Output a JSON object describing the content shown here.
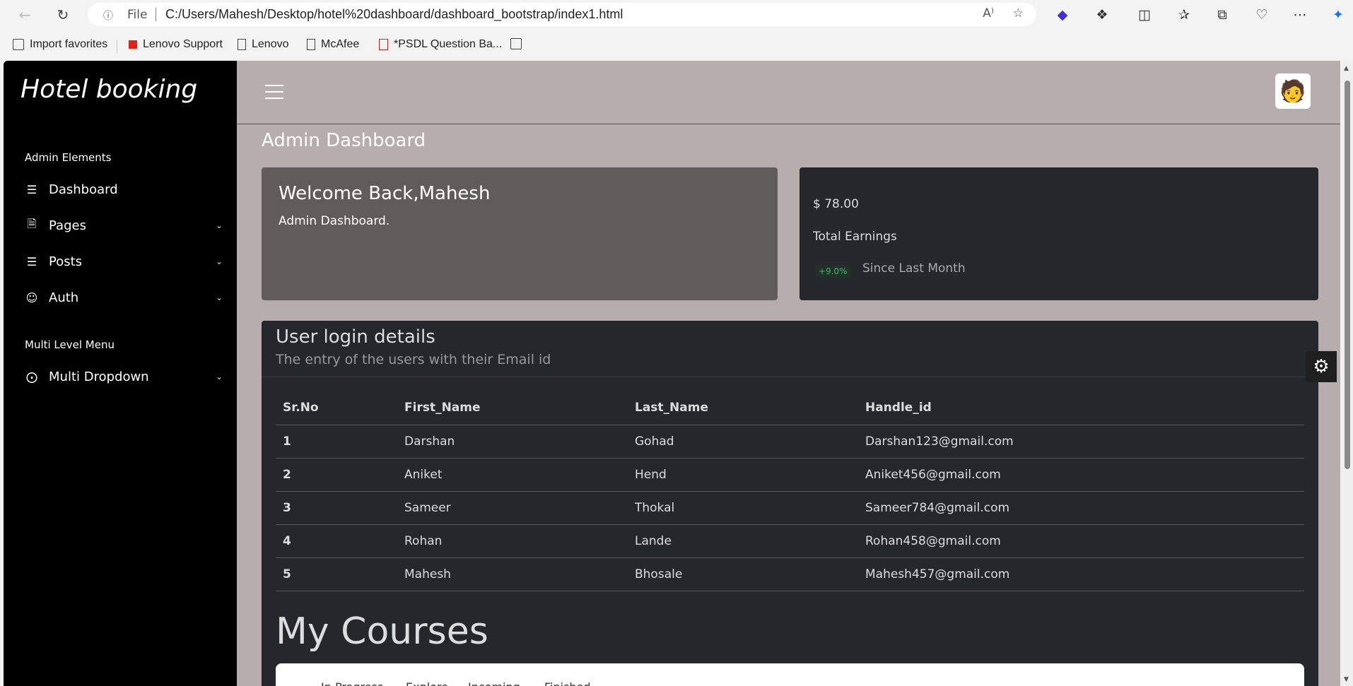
{
  "browser": {
    "file_label": "File",
    "url": "C:/Users/Mahesh/Desktop/hotel%20dashboard/dashboard_bootstrap/index1.html",
    "bookmarks": [
      {
        "label": "Import favorites",
        "icon": "import-icon"
      },
      {
        "label": "Lenovo Support",
        "icon": "lenovo-icon"
      },
      {
        "label": "Lenovo",
        "icon": "page-icon"
      },
      {
        "label": "McAfee",
        "icon": "page-icon"
      },
      {
        "label": "*PSDL Question Ba...",
        "icon": "pdf-icon"
      }
    ]
  },
  "sidebar": {
    "brand": "Hotel booking",
    "heading_admin": "Admin Elements",
    "items": [
      {
        "label": "Dashboard",
        "icon": "list-icon",
        "has_dropdown": false
      },
      {
        "label": "Pages",
        "icon": "file-icon",
        "has_dropdown": true
      },
      {
        "label": "Posts",
        "icon": "sliders-icon",
        "has_dropdown": true
      },
      {
        "label": "Auth",
        "icon": "user-icon",
        "has_dropdown": true
      }
    ],
    "heading_multi": "Multi Level Menu",
    "multi_item": {
      "label": "Multi Dropdown",
      "icon": "share-icon"
    }
  },
  "main": {
    "page_title": "Admin Dashboard",
    "welcome": {
      "title": "Welcome Back,Mahesh",
      "subtitle": "Admin Dashboard."
    },
    "earnings": {
      "amount": "$ 78.00",
      "label": "Total Earnings",
      "change": "+9.0%",
      "since": "Since Last Month",
      "change_color": "#2fbf71"
    },
    "users": {
      "title": "User login details",
      "subtitle": "The entry of the users with their Email id",
      "columns": [
        "Sr.No",
        "First_Name",
        "Last_Name",
        "Handle_id"
      ],
      "rows": [
        [
          "1",
          "Darshan",
          "Gohad",
          "Darshan123@gmail.com"
        ],
        [
          "2",
          "Aniket",
          "Hend",
          "Aniket456@gmail.com"
        ],
        [
          "3",
          "Sameer",
          "Thokal",
          "Sameer784@gmail.com"
        ],
        [
          "4",
          "Rohan",
          "Lande",
          "Rohan458@gmail.com"
        ],
        [
          "5",
          "Mahesh",
          "Bhosale",
          "Mahesh457@gmail.com"
        ]
      ]
    },
    "courses": {
      "title": "My Courses",
      "tabs": [
        "In Progress",
        "Explore",
        "Incoming",
        "Finished"
      ]
    }
  },
  "colors": {
    "page_bg": "#b8adad",
    "sidebar_bg": "#000000",
    "card_dark": "#24272b",
    "card_welcome": "#615c5c"
  }
}
